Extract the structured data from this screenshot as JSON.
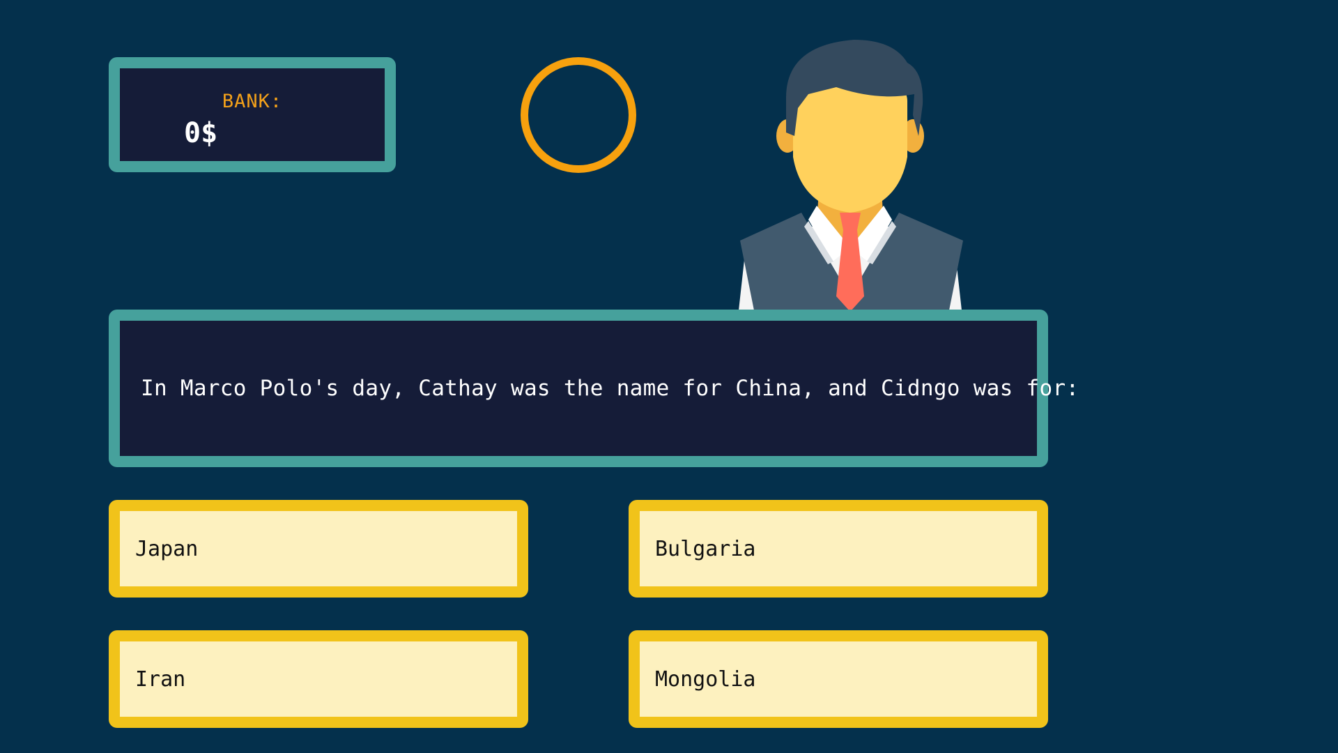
{
  "bank": {
    "label": "BANK:",
    "value": "0$"
  },
  "timer": {
    "value": ""
  },
  "host": {
    "icon": "host-avatar-icon"
  },
  "question": {
    "text": "In Marco Polo's day, Cathay was the name for China, and Cidngo was for:"
  },
  "answers": [
    {
      "label": "Japan"
    },
    {
      "label": "Bulgaria"
    },
    {
      "label": "Iran"
    },
    {
      "label": "Mongolia"
    }
  ],
  "colors": {
    "background": "#04304c",
    "panel_border": "#46a19c",
    "panel_fill": "#151c38",
    "bank_label": "#f3a11a",
    "timer_ring": "#f7a10e",
    "answer_border": "#f1c31a",
    "answer_fill": "#fdf1bf"
  }
}
